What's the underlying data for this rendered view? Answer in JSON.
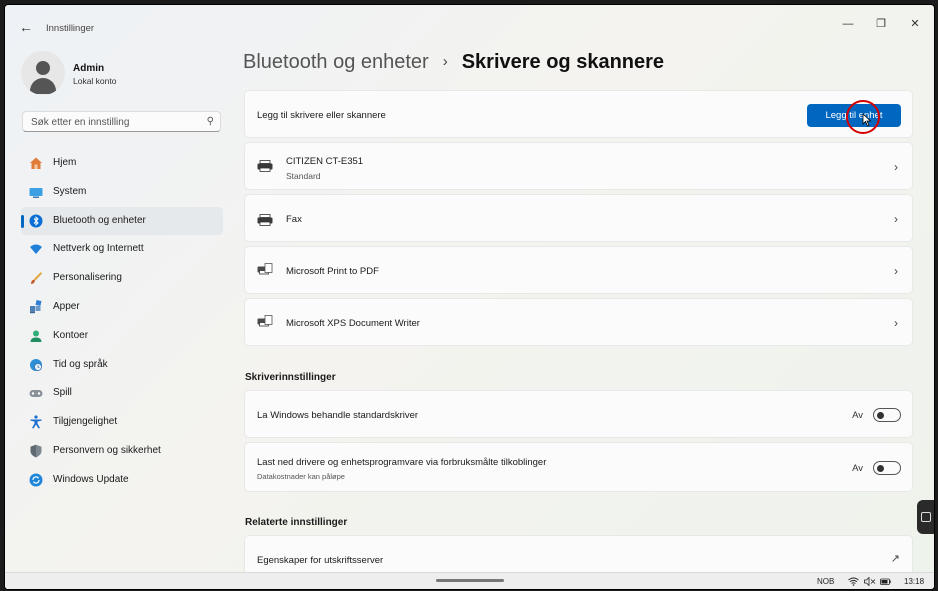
{
  "window": {
    "back_icon": "back-arrow-icon",
    "app_title": "Innstillinger",
    "controls": [
      "minimize",
      "maximize",
      "close"
    ]
  },
  "profile": {
    "name": "Admin",
    "account_type": "Lokal konto"
  },
  "search": {
    "placeholder": "Søk etter en innstilling",
    "value": ""
  },
  "sidebar": {
    "items": [
      {
        "label": "Hjem",
        "icon": "home-icon"
      },
      {
        "label": "System",
        "icon": "monitor-icon"
      },
      {
        "label": "Bluetooth og enheter",
        "icon": "bluetooth-icon",
        "active": true
      },
      {
        "label": "Nettverk og Internett",
        "icon": "wifi-icon"
      },
      {
        "label": "Personalisering",
        "icon": "brush-icon"
      },
      {
        "label": "Apper",
        "icon": "apps-icon"
      },
      {
        "label": "Kontoer",
        "icon": "account-icon"
      },
      {
        "label": "Tid og språk",
        "icon": "globe-clock-icon"
      },
      {
        "label": "Spill",
        "icon": "gamepad-icon"
      },
      {
        "label": "Tilgjengelighet",
        "icon": "accessibility-icon"
      },
      {
        "label": "Personvern og sikkerhet",
        "icon": "shield-icon"
      },
      {
        "label": "Windows Update",
        "icon": "update-icon"
      }
    ]
  },
  "breadcrumb": {
    "parent": "Bluetooth og enheter",
    "separator": "›",
    "current": "Skrivere og skannere"
  },
  "add_device": {
    "label": "Legg til skrivere eller skannere",
    "button": "Legg til enhet"
  },
  "printers": [
    {
      "name": "CITIZEN CT-E351",
      "status": "Standard"
    },
    {
      "name": "Fax",
      "status": ""
    },
    {
      "name": "Microsoft Print to PDF",
      "status": ""
    },
    {
      "name": "Microsoft XPS Document Writer",
      "status": ""
    }
  ],
  "printer_settings": {
    "title": "Skriverinnstillinger",
    "items": [
      {
        "label": "La Windows behandle standardskriver",
        "sub": "",
        "state": "Av"
      },
      {
        "label": "Last ned drivere og enhetsprogramvare via forbruksmålte tilkoblinger",
        "sub": "Datakostnader kan påløpe",
        "state": "Av"
      }
    ]
  },
  "related": {
    "title": "Relaterte innstillinger",
    "items": [
      {
        "label": "Egenskaper for utskriftsserver"
      }
    ]
  },
  "taskbar": {
    "language": "NOB",
    "time": "13:18"
  },
  "colors": {
    "accent": "#0067c0",
    "annotation_ring": "#d40000"
  }
}
